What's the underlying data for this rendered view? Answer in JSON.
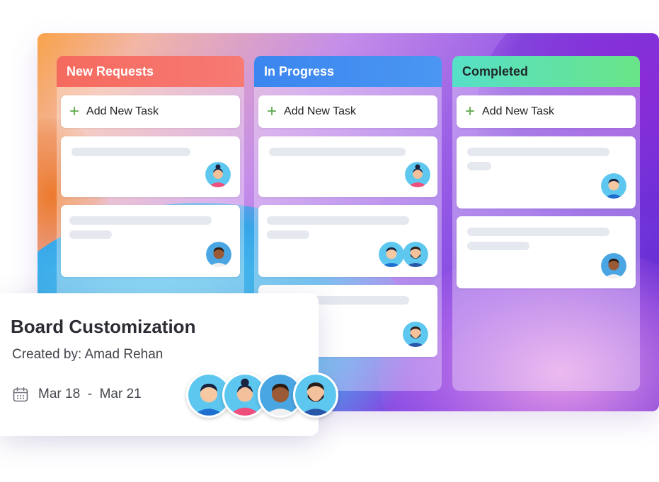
{
  "columns": [
    {
      "title": "New Requests",
      "color": "#f46464",
      "add_label": "Add New Task"
    },
    {
      "title": "In Progress",
      "color": "#3e8ef0",
      "add_label": "Add New Task"
    },
    {
      "title": "Completed",
      "color": "#5ad8a6",
      "add_label": "Add New Task"
    }
  ],
  "task_card": {
    "title": "Board Customization",
    "created_by": "Created by: Amad Rehan",
    "dates": "Mar 18  -  Mar 21",
    "icon": "calendar-icon"
  },
  "avatars": [
    "man-blue-avatar",
    "woman-pink-avatar",
    "man-dark-avatar",
    "man-beard-avatar"
  ]
}
